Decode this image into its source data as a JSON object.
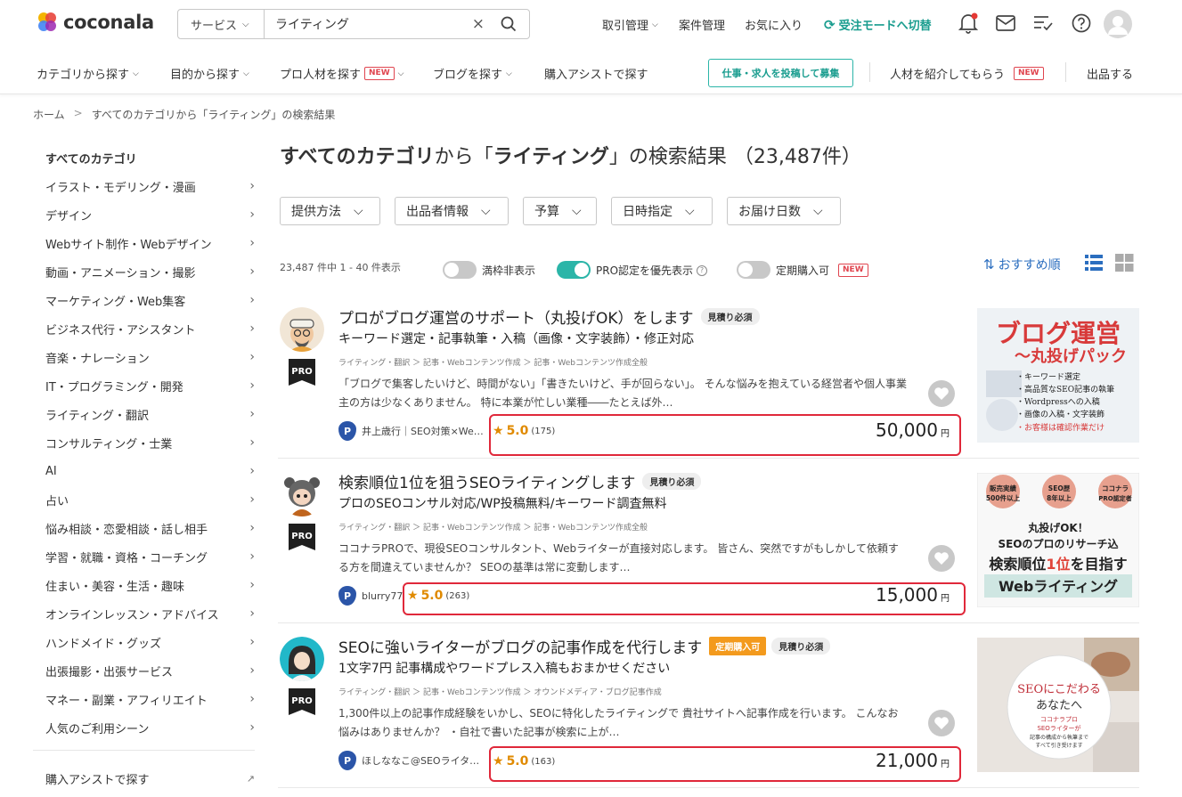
{
  "header": {
    "logo_text": "coconala",
    "search_type": "サービス",
    "search_value": "ライティング",
    "links": [
      "取引管理",
      "案件管理",
      "お気に入り"
    ],
    "mode_switch": "受注モードへ切替"
  },
  "nav": {
    "items": [
      "カテゴリから探す",
      "目的から探す",
      "プロ人材を探す",
      "ブログを探す",
      "購入アシストで探す"
    ],
    "new_badge": "NEW",
    "post_button": "仕事・求人を投稿して募集",
    "introduce": "人材を紹介してもらう",
    "sell": "出品する"
  },
  "breadcrumb": [
    "ホーム",
    ">",
    "すべてのカテゴリから「ライティング」の検索結果"
  ],
  "sidebar": {
    "heading": "すべてのカテゴリ",
    "items": [
      "イラスト・モデリング・漫画",
      "デザイン",
      "Webサイト制作・Webデザイン",
      "動画・アニメーション・撮影",
      "マーケティング・Web集客",
      "ビジネス代行・アシスタント",
      "音楽・ナレーション",
      "IT・プログラミング・開発",
      "ライティング・翻訳",
      "コンサルティング・士業",
      "AI",
      "占い",
      "悩み相談・恋愛相談・話し相手",
      "学習・就職・資格・コーチング",
      "住まい・美容・生活・趣味",
      "オンラインレッスン・アドバイス",
      "ハンドメイド・グッズ",
      "出張撮影・出張サービス",
      "マネー・副業・アフィリエイト",
      "人気のご利用シーン"
    ],
    "assist": "購入アシストで探す"
  },
  "title": {
    "part1": "すべてのカテゴリ",
    "part2": "から「",
    "part3": "ライティング",
    "part4": "」の検索結果",
    "count": "（23,487件）"
  },
  "filters": [
    "提供方法",
    "出品者情報",
    "予算",
    "日時指定",
    "お届け日数"
  ],
  "results_bar": {
    "count": "23,487 件中 1 - 40 件表示",
    "toggle1": "満枠非表示",
    "toggle2": "PRO認定を優先表示",
    "toggle3": "定期購入可",
    "new_badge": "NEW",
    "sort": "おすすめ順"
  },
  "listings": [
    {
      "title": "プロがブログ運営のサポート（丸投げOK）をします",
      "tags": [
        "見積り必須"
      ],
      "subtitle": "キーワード選定・記事執筆・入稿（画像・文字装飾）・修正対応",
      "category": "ライティング・翻訳 ＞ 記事・Webコンテンツ作成 ＞ 記事・Webコンテンツ作成全般",
      "description": "「ブログで集客したいけど、時間がない」「書きたいけど、手が回らない」。 そんな悩みを抱えている経営者や個人事業主の方は少なくありません。 特に本業が忙しい業種――たとえば外…",
      "seller": "井上歳行｜SEO対策×We…",
      "rating": "5.0",
      "reviews": "(175)",
      "price": "50,000",
      "yen": "円",
      "pro": "PRO",
      "thumb": {
        "title1": "ブログ運営",
        "title2": "〜丸投げパック",
        "bullets": [
          "・キーワード選定",
          "・高品質なSEO記事の執筆",
          "・Wordpressへの入稿",
          "・画像の入稿・文字装飾",
          "・お客様は確認作業だけ"
        ]
      }
    },
    {
      "title": "検索順位1位を狙うSEOライティングします",
      "tags": [
        "見積り必須"
      ],
      "subtitle": "プロのSEOコンサル対応/WP投稿無料/キーワード調査無料",
      "category": "ライティング・翻訳 ＞ 記事・Webコンテンツ作成 ＞ 記事・Webコンテンツ作成全般",
      "description": "ココナラPROで、現役SEOコンサルタント、Webライターが直接対応します。 皆さん、突然ですがもしかして依頼する方を間違えていませんか？ SEOの基準は常に変動します…",
      "seller": "blurry77",
      "rating": "5.0",
      "reviews": "(263)",
      "price": "15,000",
      "yen": "円",
      "pro": "PRO",
      "thumb": {
        "c1a": "販売実績",
        "c1b": "500件以上",
        "c2a": "SEO歴",
        "c2b": "8年以上",
        "c3a": "ココナラ",
        "c3b": "PRO認定者",
        "l1": "丸投げOK！",
        "l2": "SEOのプロのリサーチ込",
        "l3a": "検索順位",
        "l3b": "1位",
        "l3c": "を目指す",
        "l4": "Webライティング"
      }
    },
    {
      "title": "SEOに強いライターがブログの記事作成を代行します",
      "tags": [
        "定期購入可",
        "見積り必須"
      ],
      "subtitle": "1文字7円 記事構成やワードプレス入稿もおまかせください",
      "category": "ライティング・翻訳 ＞ 記事・Webコンテンツ作成 ＞ オウンドメディア・ブログ記事作成",
      "description": "1,300件以上の記事作成経験をいかし、SEOに特化したライティングで 貴社サイトへ記事作成を行います。 こんなお悩みはありませんか？ ・自社で書いた記事が検索に上が…",
      "seller": "ほしななこ@SEOライタ…",
      "rating": "5.0",
      "reviews": "(163)",
      "price": "21,000",
      "yen": "円",
      "pro": "PRO",
      "thumb": {
        "l1": "SEOにこだわる",
        "l2": "あなたへ",
        "l3": "ココナラプロ",
        "l4": "SEOライターが",
        "l5": "記事の構成から執筆まで",
        "l6": "すべて引き受けます"
      }
    }
  ],
  "colors": {
    "teal": "#2bb5a8",
    "red": "#e0283a",
    "star": "#e08a00",
    "link": "#2b6ebf"
  }
}
